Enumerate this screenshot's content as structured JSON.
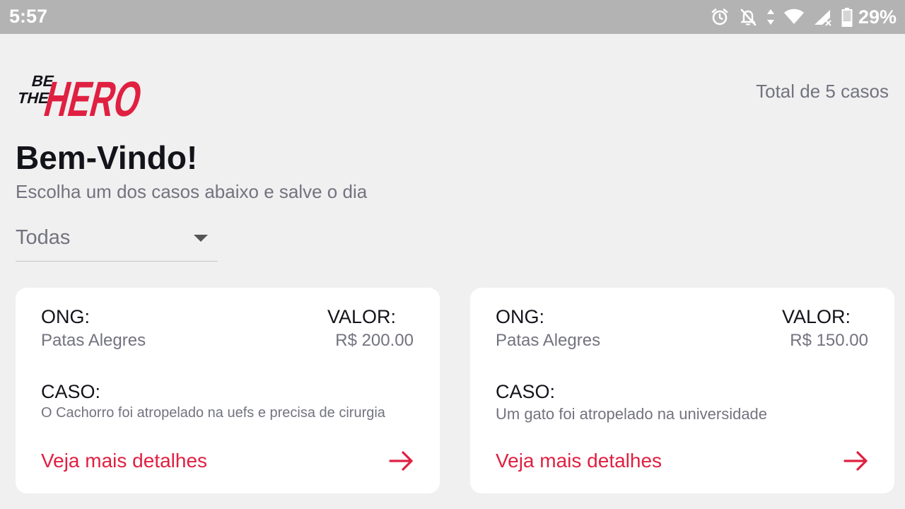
{
  "status_bar": {
    "time": "5:57",
    "battery_percent": "29%",
    "icons": [
      "alarm-icon",
      "bell-off-icon",
      "data-arrows-icon",
      "wifi-icon",
      "signal-icon",
      "battery-icon"
    ]
  },
  "header": {
    "logo_top": "BE",
    "logo_mid": "THE",
    "logo_main": "HERO",
    "total_text": "Total de 5 casos",
    "title": "Bem-Vindo!",
    "subtitle": "Escolha um dos casos abaixo e salve o dia"
  },
  "filter": {
    "selected": "Todas"
  },
  "colors": {
    "accent": "#e02041",
    "background": "#f0f0f0",
    "card": "#ffffff",
    "muted_text": "#737380",
    "status_bar": "#b3b3b3"
  },
  "cases": [
    {
      "ong_label": "ONG:",
      "ong": "Patas Alegres",
      "valor_label": "VALOR:",
      "valor": "R$ 200.00",
      "caso_label": "CASO:",
      "caso": "O Cachorro foi atropelado na uefs e precisa de cirurgia",
      "details_label": "Veja mais detalhes"
    },
    {
      "ong_label": "ONG:",
      "ong": "Patas Alegres",
      "valor_label": "VALOR:",
      "valor": "R$ 150.00",
      "caso_label": "CASO:",
      "caso": "Um gato foi atropelado na universidade",
      "details_label": "Veja mais detalhes"
    }
  ]
}
